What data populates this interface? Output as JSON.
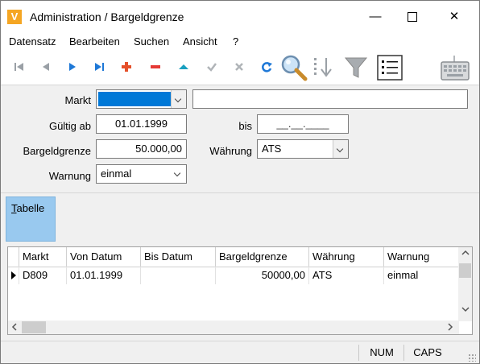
{
  "window": {
    "title": "Administration / Bargeldgrenze",
    "app_icon_letter": "V"
  },
  "window_controls": {
    "minimize": "—",
    "close": "✕"
  },
  "menu": [
    "Datensatz",
    "Bearbeiten",
    "Suchen",
    "Ansicht",
    "?"
  ],
  "toolbar": {
    "icons": [
      "first-record-icon",
      "previous-record-icon",
      "next-record-icon",
      "last-record-icon",
      "add-record-icon",
      "delete-record-icon",
      "edit-record-icon",
      "confirm-icon",
      "cancel-icon",
      "refresh-icon",
      "search-icon",
      "sort-icon",
      "filter-icon",
      "list-view-icon",
      "keyboard-icon"
    ],
    "colors": {
      "nav": "#1e78d7",
      "add": "#e5502a",
      "delete": "#e53935",
      "edit": "#1aa0c0"
    }
  },
  "form": {
    "markt": {
      "label": "Markt",
      "value": "",
      "description": ""
    },
    "gueltig_ab": {
      "label": "Gültig ab",
      "value": "01.01.1999"
    },
    "bis": {
      "label": "bis",
      "value": "__.__.____"
    },
    "bargeldgrenze": {
      "label": "Bargeldgrenze",
      "value": "50.000,00"
    },
    "waehrung": {
      "label": "Währung",
      "value": "ATS"
    },
    "warnung": {
      "label": "Warnung",
      "value": "einmal"
    }
  },
  "tab": {
    "label_first": "T",
    "label_rest": "abelle"
  },
  "table": {
    "columns": [
      "Markt",
      "Von Datum",
      "Bis Datum",
      "Bargeldgrenze",
      "Währung",
      "Warnung"
    ],
    "rows": [
      {
        "markt": "D809",
        "von": "01.01.1999",
        "bis": "",
        "grenze": "50000,00",
        "waehrung": "ATS",
        "warnung": "einmal"
      }
    ]
  },
  "status": {
    "num": "NUM",
    "caps": "CAPS"
  },
  "colors": {
    "accent_selection": "#0078d7",
    "tab_active": "#99c9ef"
  }
}
